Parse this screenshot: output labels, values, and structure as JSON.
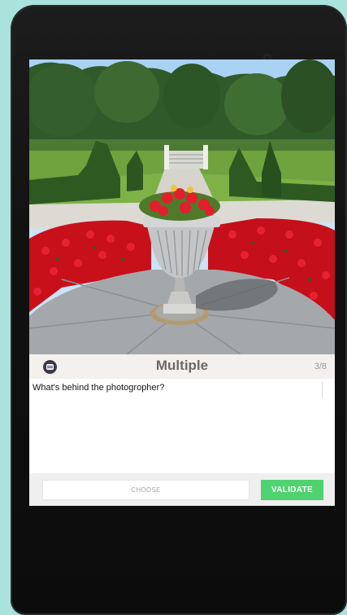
{
  "header": {
    "title": "Multiple",
    "progress": "3/8",
    "icon": "chat-icon"
  },
  "question": {
    "text": "What's behind the photogropher?"
  },
  "footer": {
    "choose_label": "CHOOSE",
    "validate_label": "VALIDATE"
  },
  "colors": {
    "validate": "#4fd270",
    "header_bg": "#f3f0ee",
    "background": "#a9e3dc"
  }
}
